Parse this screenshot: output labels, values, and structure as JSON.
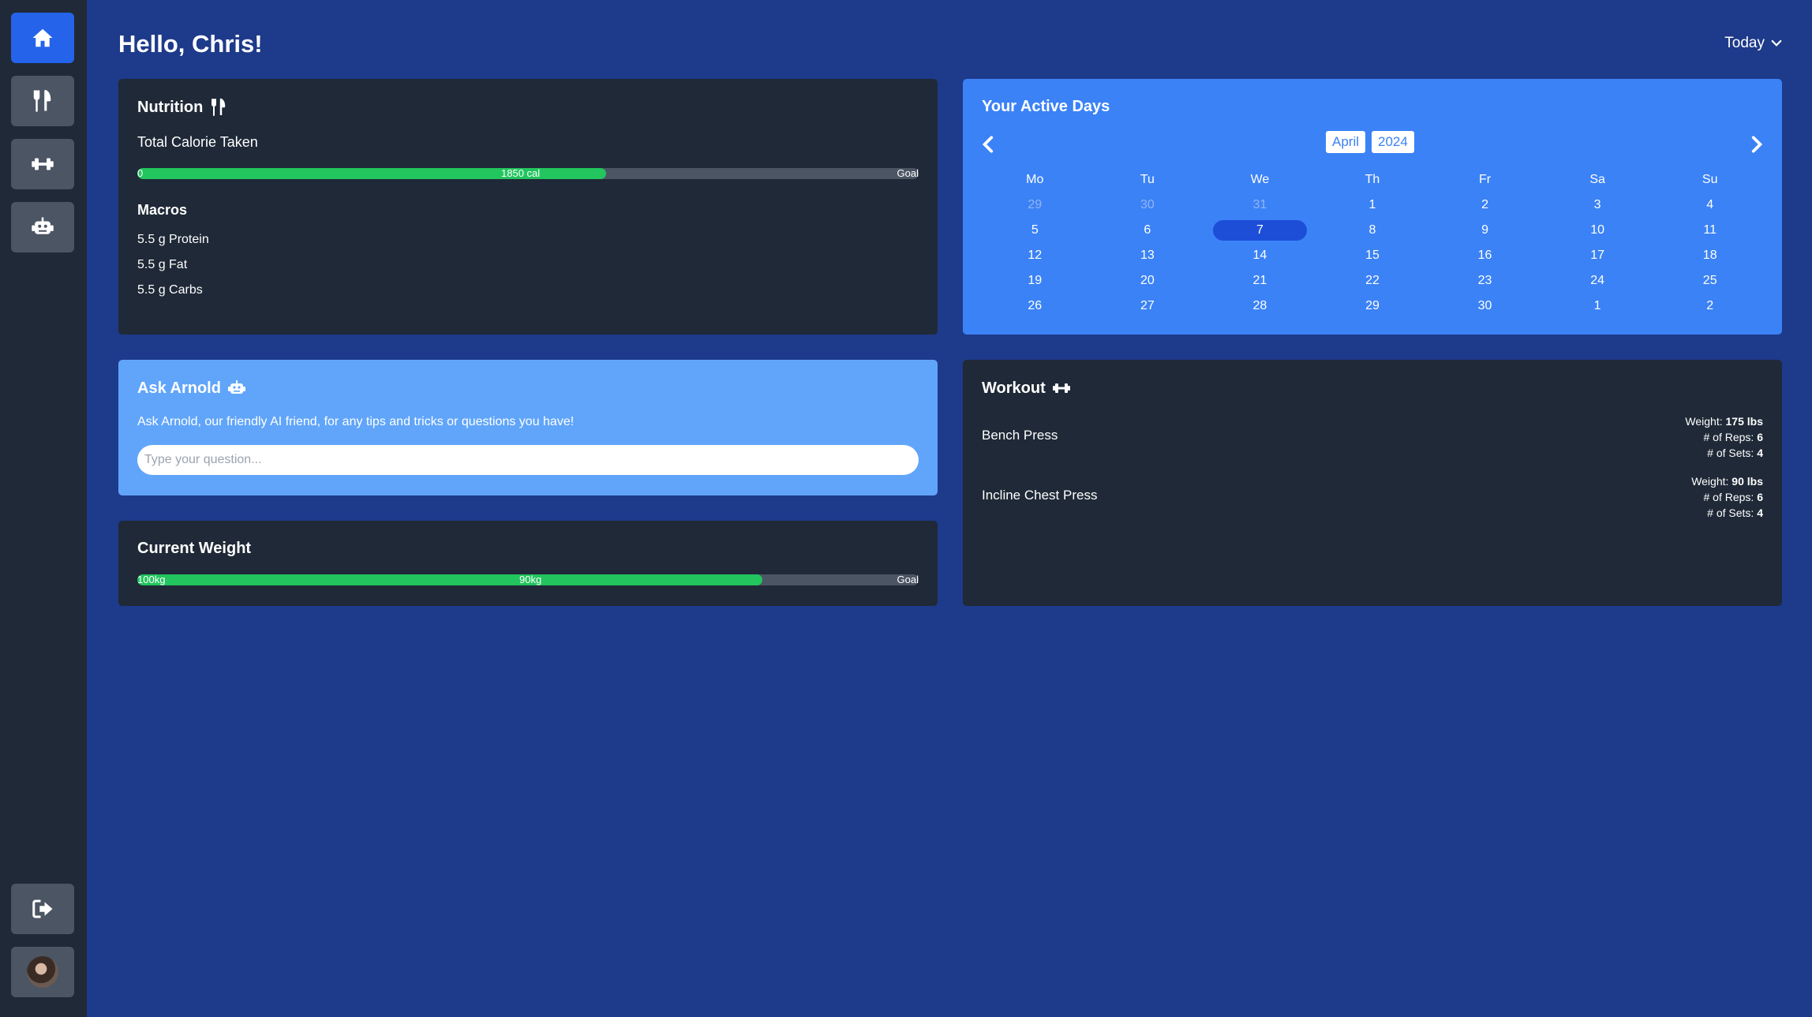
{
  "sidebar": {
    "items": [
      {
        "icon": "home-icon"
      },
      {
        "icon": "utensils-icon"
      },
      {
        "icon": "dumbbell-icon"
      },
      {
        "icon": "robot-icon"
      }
    ],
    "bottom": [
      {
        "icon": "sign-out-icon"
      },
      {
        "icon": "user-avatar"
      }
    ]
  },
  "header": {
    "greeting": "Hello, Chris!",
    "range_label": "Today"
  },
  "nutrition": {
    "title": "Nutrition",
    "subtitle": "Total Calorie Taken",
    "progress_fraction": 0.6,
    "label_start": "0",
    "label_value": "1850 cal",
    "label_goal": "Goal",
    "macros_title": "Macros",
    "macros": [
      "5.5 g Protein",
      "5.5 g Fat",
      "5.5 g Carbs"
    ]
  },
  "calendar": {
    "title": "Your Active Days",
    "month": "April",
    "year": "2024",
    "weekdays": [
      "Mo",
      "Tu",
      "We",
      "Th",
      "Fr",
      "Sa",
      "Su"
    ],
    "weeks": [
      [
        "29",
        "30",
        "31",
        "1",
        "2",
        "3",
        "4"
      ],
      [
        "5",
        "6",
        "7",
        "8",
        "9",
        "10",
        "11"
      ],
      [
        "12",
        "13",
        "14",
        "15",
        "16",
        "17",
        "18"
      ],
      [
        "19",
        "20",
        "21",
        "22",
        "23",
        "24",
        "25"
      ],
      [
        "26",
        "27",
        "28",
        "29",
        "30",
        "1",
        "2"
      ]
    ],
    "muted_first_week_count": 3,
    "selected": "7"
  },
  "ask": {
    "title": "Ask Arnold",
    "description": "Ask Arnold, our friendly AI friend, for any tips and tricks or questions you have!",
    "placeholder": "Type your question..."
  },
  "workout": {
    "title": "Workout",
    "exercises": [
      {
        "name": "Bench Press",
        "weight_label": "Weight:",
        "weight": "175 lbs",
        "reps_label": "# of Reps:",
        "reps": "6",
        "sets_label": "# of Sets:",
        "sets": "4"
      },
      {
        "name": "Incline Chest Press",
        "weight_label": "Weight:",
        "weight": "90 lbs",
        "reps_label": "# of Reps:",
        "reps": "6",
        "sets_label": "# of Sets:",
        "sets": "4"
      }
    ]
  },
  "weight": {
    "title": "Current Weight",
    "progress_fraction": 0.8,
    "label_start": "100kg",
    "label_value": "90kg",
    "label_goal": "Goal"
  },
  "colors": {
    "background": "#1e3a8a",
    "sidebar": "#1f2937",
    "card_dark": "#1f2937",
    "card_blue": "#3b82f6",
    "card_light_blue": "#60a5fa",
    "progress_fill": "#22c55e",
    "active_nav": "#2563eb"
  }
}
